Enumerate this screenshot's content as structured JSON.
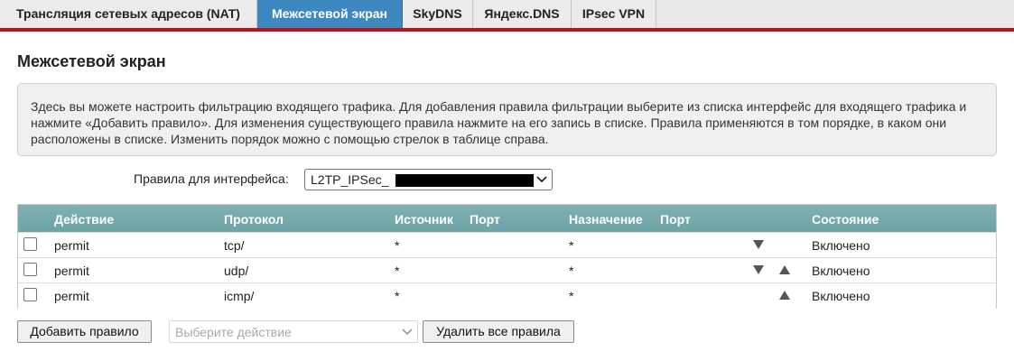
{
  "tabs": [
    {
      "label": "Трансляция сетевых адресов (NAT)",
      "active": false
    },
    {
      "label": "Межсетевой экран",
      "active": true
    },
    {
      "label": "SkyDNS",
      "active": false
    },
    {
      "label": "Яндекс.DNS",
      "active": false
    },
    {
      "label": "IPsec VPN",
      "active": false
    }
  ],
  "page_title": "Межсетевой экран",
  "info_text": "Здесь вы можете настроить фильтрацию входящего трафика. Для добавления правила фильтрации выберите из списка интерфейс для входящего трафика и нажмите «Добавить правило». Для изменения существующего правила нажмите на его запись в списке. Правила применяются в том порядке, в каком они расположены в списке. Изменить порядок можно с помощью стрелок в таблице справа.",
  "interface": {
    "label": "Правила для интерфейса:",
    "value": "L2TP_IPSec_"
  },
  "table": {
    "headers": {
      "action": "Действие",
      "protocol": "Протокол",
      "source": "Источник",
      "source_port": "Порт",
      "destination": "Назначение",
      "destination_port": "Порт",
      "state": "Состояние"
    },
    "rows": [
      {
        "action": "permit",
        "protocol": "tcp/",
        "source": "*",
        "destination": "*",
        "state": "Включено",
        "down": true,
        "up": false
      },
      {
        "action": "permit",
        "protocol": "udp/",
        "source": "*",
        "destination": "*",
        "state": "Включено",
        "down": true,
        "up": true
      },
      {
        "action": "permit",
        "protocol": "icmp/",
        "source": "*",
        "destination": "*",
        "state": "Включено",
        "down": false,
        "up": true
      }
    ]
  },
  "buttons": {
    "add_rule": "Добавить правило",
    "action_placeholder": "Выберите действие",
    "delete_all": "Удалить все правила"
  },
  "colors": {
    "active_tab": "#3e88c1",
    "accent_line": "#b3141f",
    "table_header": "#76aaac"
  }
}
